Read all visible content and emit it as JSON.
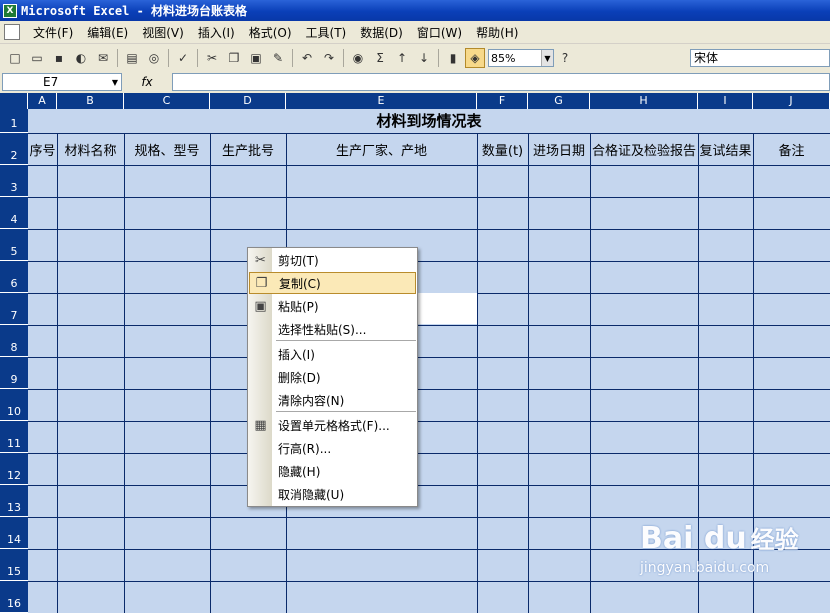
{
  "window": {
    "title": "Microsoft Excel - 材料进场台账表格"
  },
  "menu": [
    "文件(F)",
    "编辑(E)",
    "视图(V)",
    "插入(I)",
    "格式(O)",
    "工具(T)",
    "数据(D)",
    "窗口(W)",
    "帮助(H)"
  ],
  "toolbar": {
    "zoom": "85%",
    "font": "宋体"
  },
  "formula_bar": {
    "cell_ref": "E7",
    "fx": "fx",
    "formula": ""
  },
  "columns": [
    "A",
    "B",
    "C",
    "D",
    "E",
    "F",
    "G",
    "H",
    "I",
    "J"
  ],
  "rows": [
    "1",
    "2",
    "3",
    "4",
    "5",
    "6",
    "7",
    "8",
    "9",
    "10",
    "11",
    "12",
    "13",
    "14",
    "15",
    "16"
  ],
  "sheet": {
    "title": "材料到场情况表",
    "headers": [
      "序号",
      "材料名称",
      "规格、型号",
      "生产批号",
      "生产厂家、产地",
      "数量(t)",
      "进场日期",
      "合格证及检验报告",
      "复试结果",
      "备注"
    ]
  },
  "context_menu": [
    {
      "label": "剪切(T)",
      "icon": "scissors-icon"
    },
    {
      "label": "复制(C)",
      "icon": "copy-icon",
      "highlighted": true
    },
    {
      "label": "粘贴(P)",
      "icon": "paste-icon"
    },
    {
      "label": "选择性粘贴(S)...",
      "icon": ""
    },
    {
      "label": "插入(I)",
      "icon": ""
    },
    {
      "label": "删除(D)",
      "icon": ""
    },
    {
      "label": "清除内容(N)",
      "icon": ""
    },
    {
      "label": "设置单元格格式(F)...",
      "icon": "format-cells-icon"
    },
    {
      "label": "行高(R)...",
      "icon": ""
    },
    {
      "label": "隐藏(H)",
      "icon": ""
    },
    {
      "label": "取消隐藏(U)",
      "icon": ""
    }
  ],
  "watermark": {
    "logo": "Bai du",
    "brand": "经验",
    "url": "jingyan.baidu.com"
  }
}
